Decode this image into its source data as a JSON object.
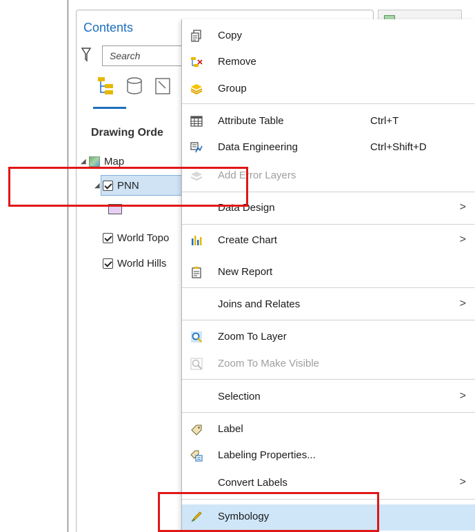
{
  "contents_pane": {
    "title": "Contents",
    "search_placeholder": "Search",
    "drawing_order_label": "Drawing Orde",
    "tree": {
      "map_label": "Map",
      "pnn_label": "PNN",
      "world_topo_label": "World Topo",
      "world_hillshade_label": "World Hills"
    }
  },
  "context_menu": {
    "items": [
      {
        "label": "Copy",
        "icon": "copy-icon",
        "enabled": true
      },
      {
        "label": "Remove",
        "icon": "remove-icon",
        "enabled": true
      },
      {
        "label": "Group",
        "icon": "group-icon",
        "enabled": true
      },
      {
        "label": "Attribute Table",
        "shortcut": "Ctrl+T",
        "icon": "table-icon",
        "enabled": true
      },
      {
        "label": "Data Engineering",
        "shortcut": "Ctrl+Shift+D",
        "icon": "data-engineering-icon",
        "enabled": true
      },
      {
        "label": "Add Error Layers",
        "icon": "error-layers-icon",
        "enabled": false
      },
      {
        "label": "Data Design",
        "submenu": true,
        "enabled": true
      },
      {
        "label": "Create Chart",
        "submenu": true,
        "icon": "chart-icon",
        "enabled": true
      },
      {
        "label": "New Report",
        "icon": "report-icon",
        "enabled": true
      },
      {
        "label": "Joins and Relates",
        "submenu": true,
        "enabled": true
      },
      {
        "label": "Zoom To Layer",
        "icon": "zoom-layer-icon",
        "enabled": true
      },
      {
        "label": "Zoom To Make Visible",
        "icon": "zoom-visible-icon",
        "enabled": false
      },
      {
        "label": "Selection",
        "submenu": true,
        "enabled": true
      },
      {
        "label": "Label",
        "icon": "label-icon",
        "enabled": true
      },
      {
        "label": "Labeling Properties...",
        "icon": "labeling-properties-icon",
        "enabled": true
      },
      {
        "label": "Convert Labels",
        "submenu": true,
        "enabled": true
      },
      {
        "label": "Symbology",
        "icon": "symbology-icon",
        "enabled": true,
        "highlighted": true
      }
    ],
    "submenu_arrow": ">"
  },
  "colors": {
    "accent": "#1d6fbd",
    "highlight": "#cfe6f8",
    "annotation_red": "#e01616"
  }
}
